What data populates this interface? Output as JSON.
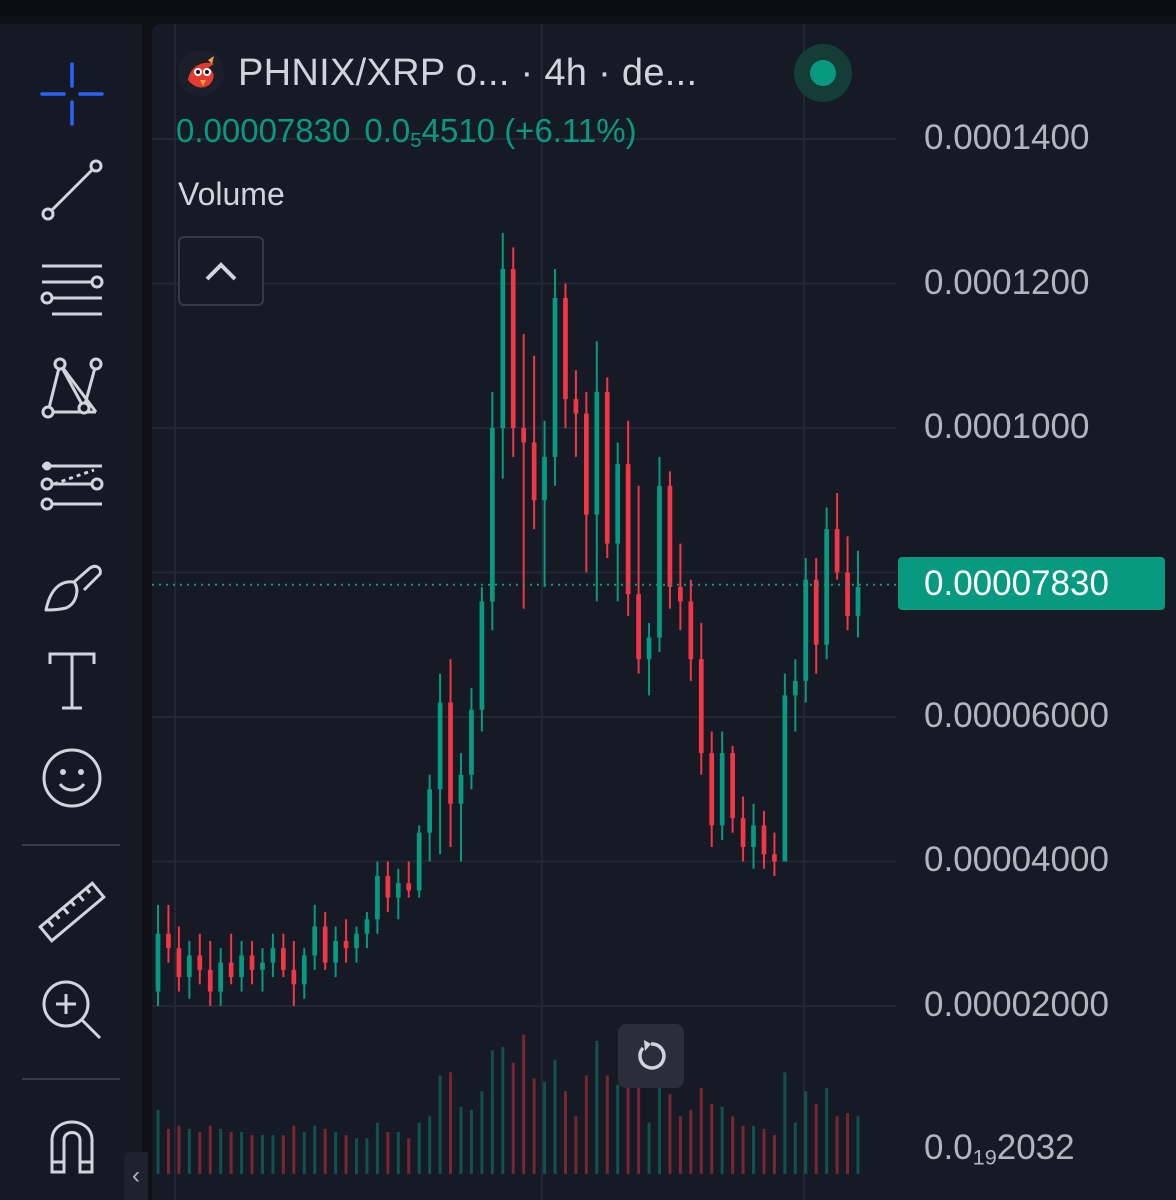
{
  "header": {
    "title": "PHNIX/XRP o... · 4h · de...",
    "last_price": "0.00007830",
    "change_prefix": "0.0",
    "change_sub": "5",
    "change_rest": "4510 (+6.11%)",
    "status": "live"
  },
  "indicator": {
    "volume_label": "Volume"
  },
  "toolbar": {
    "tools": [
      "crosshair-icon",
      "trend-line-icon",
      "fib-retracement-icon",
      "pattern-icon",
      "prediction-icon",
      "brush-icon",
      "text-icon",
      "emoji-icon",
      "ruler-icon",
      "zoom-in-icon",
      "magnet-icon"
    ]
  },
  "price_axis": {
    "labels": [
      "0.0001400",
      "0.0001200",
      "0.0001000",
      "0.00006000",
      "0.00004000",
      "0.00002000"
    ],
    "volume_prefix": "0.0",
    "volume_sub": "19",
    "volume_rest": "2032",
    "current_price": "0.00007830"
  },
  "colors": {
    "up": "#089981",
    "down": "#f23645",
    "background": "#161a25"
  },
  "chart_data": {
    "type": "candlestick",
    "timeframe": "4h",
    "current_price": 7.83e-05,
    "y_range": [
      1.5e-05,
      0.000155
    ],
    "grid": true,
    "ohlc": [
      [
        2.2e-05,
        3.4e-05,
        2e-05,
        3e-05
      ],
      [
        3e-05,
        3.4e-05,
        2.6e-05,
        2.8e-05
      ],
      [
        2.8e-05,
        3.1e-05,
        2.2e-05,
        2.4e-05
      ],
      [
        2.4e-05,
        2.9e-05,
        2.1e-05,
        2.7e-05
      ],
      [
        2.7e-05,
        3e-05,
        2.3e-05,
        2.5e-05
      ],
      [
        2.5e-05,
        2.9e-05,
        2e-05,
        2.2e-05
      ],
      [
        2.2e-05,
        2.8e-05,
        2e-05,
        2.6e-05
      ],
      [
        2.6e-05,
        3e-05,
        2.3e-05,
        2.4e-05
      ],
      [
        2.4e-05,
        2.9e-05,
        2.2e-05,
        2.7e-05
      ],
      [
        2.7e-05,
        2.9e-05,
        2.3e-05,
        2.5e-05
      ],
      [
        2.5e-05,
        2.8e-05,
        2.2e-05,
        2.6e-05
      ],
      [
        2.6e-05,
        3e-05,
        2.4e-05,
        2.8e-05
      ],
      [
        2.8e-05,
        3e-05,
        2.4e-05,
        2.5e-05
      ],
      [
        2.5e-05,
        2.9e-05,
        2e-05,
        2.3e-05
      ],
      [
        2.3e-05,
        2.8e-05,
        2.1e-05,
        2.7e-05
      ],
      [
        2.7e-05,
        3.4e-05,
        2.5e-05,
        3.1e-05
      ],
      [
        3.1e-05,
        3.3e-05,
        2.5e-05,
        2.6e-05
      ],
      [
        2.6e-05,
        3.1e-05,
        2.4e-05,
        2.9e-05
      ],
      [
        2.9e-05,
        3.2e-05,
        2.6e-05,
        2.8e-05
      ],
      [
        2.8e-05,
        3.1e-05,
        2.6e-05,
        3e-05
      ],
      [
        3e-05,
        3.3e-05,
        2.8e-05,
        3.2e-05
      ],
      [
        3.2e-05,
        4e-05,
        3e-05,
        3.8e-05
      ],
      [
        3.8e-05,
        4e-05,
        3.3e-05,
        3.5e-05
      ],
      [
        3.5e-05,
        3.9e-05,
        3.2e-05,
        3.7e-05
      ],
      [
        3.7e-05,
        4e-05,
        3.5e-05,
        3.6e-05
      ],
      [
        3.6e-05,
        4.5e-05,
        3.5e-05,
        4.4e-05
      ],
      [
        4.4e-05,
        5.2e-05,
        4e-05,
        5e-05
      ],
      [
        5e-05,
        6.6e-05,
        4.1e-05,
        6.2e-05
      ],
      [
        6.2e-05,
        6.8e-05,
        4.2e-05,
        4.8e-05
      ],
      [
        4.8e-05,
        5.5e-05,
        4e-05,
        5.2e-05
      ],
      [
        5.2e-05,
        6.4e-05,
        5e-05,
        6.1e-05
      ],
      [
        6.1e-05,
        7.8e-05,
        5.8e-05,
        7.6e-05
      ],
      [
        7.6e-05,
        0.000105,
        7.2e-05,
        0.0001
      ],
      [
        0.0001,
        0.000127,
        9.3e-05,
        0.000122
      ],
      [
        0.000122,
        0.000125,
        9.6e-05,
        0.0001
      ],
      [
        0.0001,
        0.000113,
        7.5e-05,
        9.8e-05
      ],
      [
        9.8e-05,
        0.00011,
        8.6e-05,
        9e-05
      ],
      [
        9e-05,
        0.000101,
        7.8e-05,
        9.6e-05
      ],
      [
        9.6e-05,
        0.000122,
        9.2e-05,
        0.000118
      ],
      [
        0.000118,
        0.00012,
        0.0001,
        0.000104
      ],
      [
        0.000104,
        0.000108,
        9.6e-05,
        0.000102
      ],
      [
        0.000102,
        0.000105,
        8e-05,
        8.8e-05
      ],
      [
        8.8e-05,
        0.000112,
        7.6e-05,
        0.000105
      ],
      [
        0.000105,
        0.000107,
        8.2e-05,
        8.4e-05
      ],
      [
        8.4e-05,
        9.8e-05,
        7.6e-05,
        9.5e-05
      ],
      [
        9.5e-05,
        0.000101,
        7.4e-05,
        7.7e-05
      ],
      [
        7.7e-05,
        9.2e-05,
        6.6e-05,
        6.8e-05
      ],
      [
        6.8e-05,
        7.3e-05,
        6.3e-05,
        7.1e-05
      ],
      [
        7.1e-05,
        9.6e-05,
        6.9e-05,
        9.2e-05
      ],
      [
        9.2e-05,
        9.4e-05,
        7.5e-05,
        7.8e-05
      ],
      [
        7.8e-05,
        8.4e-05,
        7.2e-05,
        7.6e-05
      ],
      [
        7.6e-05,
        7.9e-05,
        6.5e-05,
        6.8e-05
      ],
      [
        6.8e-05,
        7.3e-05,
        5.2e-05,
        5.5e-05
      ],
      [
        5.5e-05,
        5.8e-05,
        4.2e-05,
        4.5e-05
      ],
      [
        4.5e-05,
        5.8e-05,
        4.3e-05,
        5.5e-05
      ],
      [
        5.5e-05,
        5.6e-05,
        4.4e-05,
        4.6e-05
      ],
      [
        4.6e-05,
        4.9e-05,
        4e-05,
        4.2e-05
      ],
      [
        4.2e-05,
        4.8e-05,
        3.9e-05,
        4.5e-05
      ],
      [
        4.5e-05,
        4.7e-05,
        3.9e-05,
        4.1e-05
      ],
      [
        4.1e-05,
        4.4e-05,
        3.8e-05,
        4e-05
      ],
      [
        4e-05,
        6.6e-05,
        4e-05,
        6.3e-05
      ],
      [
        6.3e-05,
        6.8e-05,
        5.8e-05,
        6.5e-05
      ],
      [
        6.5e-05,
        8.2e-05,
        6.2e-05,
        7.9e-05
      ],
      [
        7.9e-05,
        8.2e-05,
        6.6e-05,
        7e-05
      ],
      [
        7e-05,
        8.9e-05,
        6.8e-05,
        8.6e-05
      ],
      [
        8.6e-05,
        9.1e-05,
        7.9e-05,
        8e-05
      ],
      [
        8e-05,
        8.5e-05,
        7.2e-05,
        7.4e-05
      ],
      [
        7.4e-05,
        8.3e-05,
        7.1e-05,
        7.8e-05
      ]
    ]
  }
}
